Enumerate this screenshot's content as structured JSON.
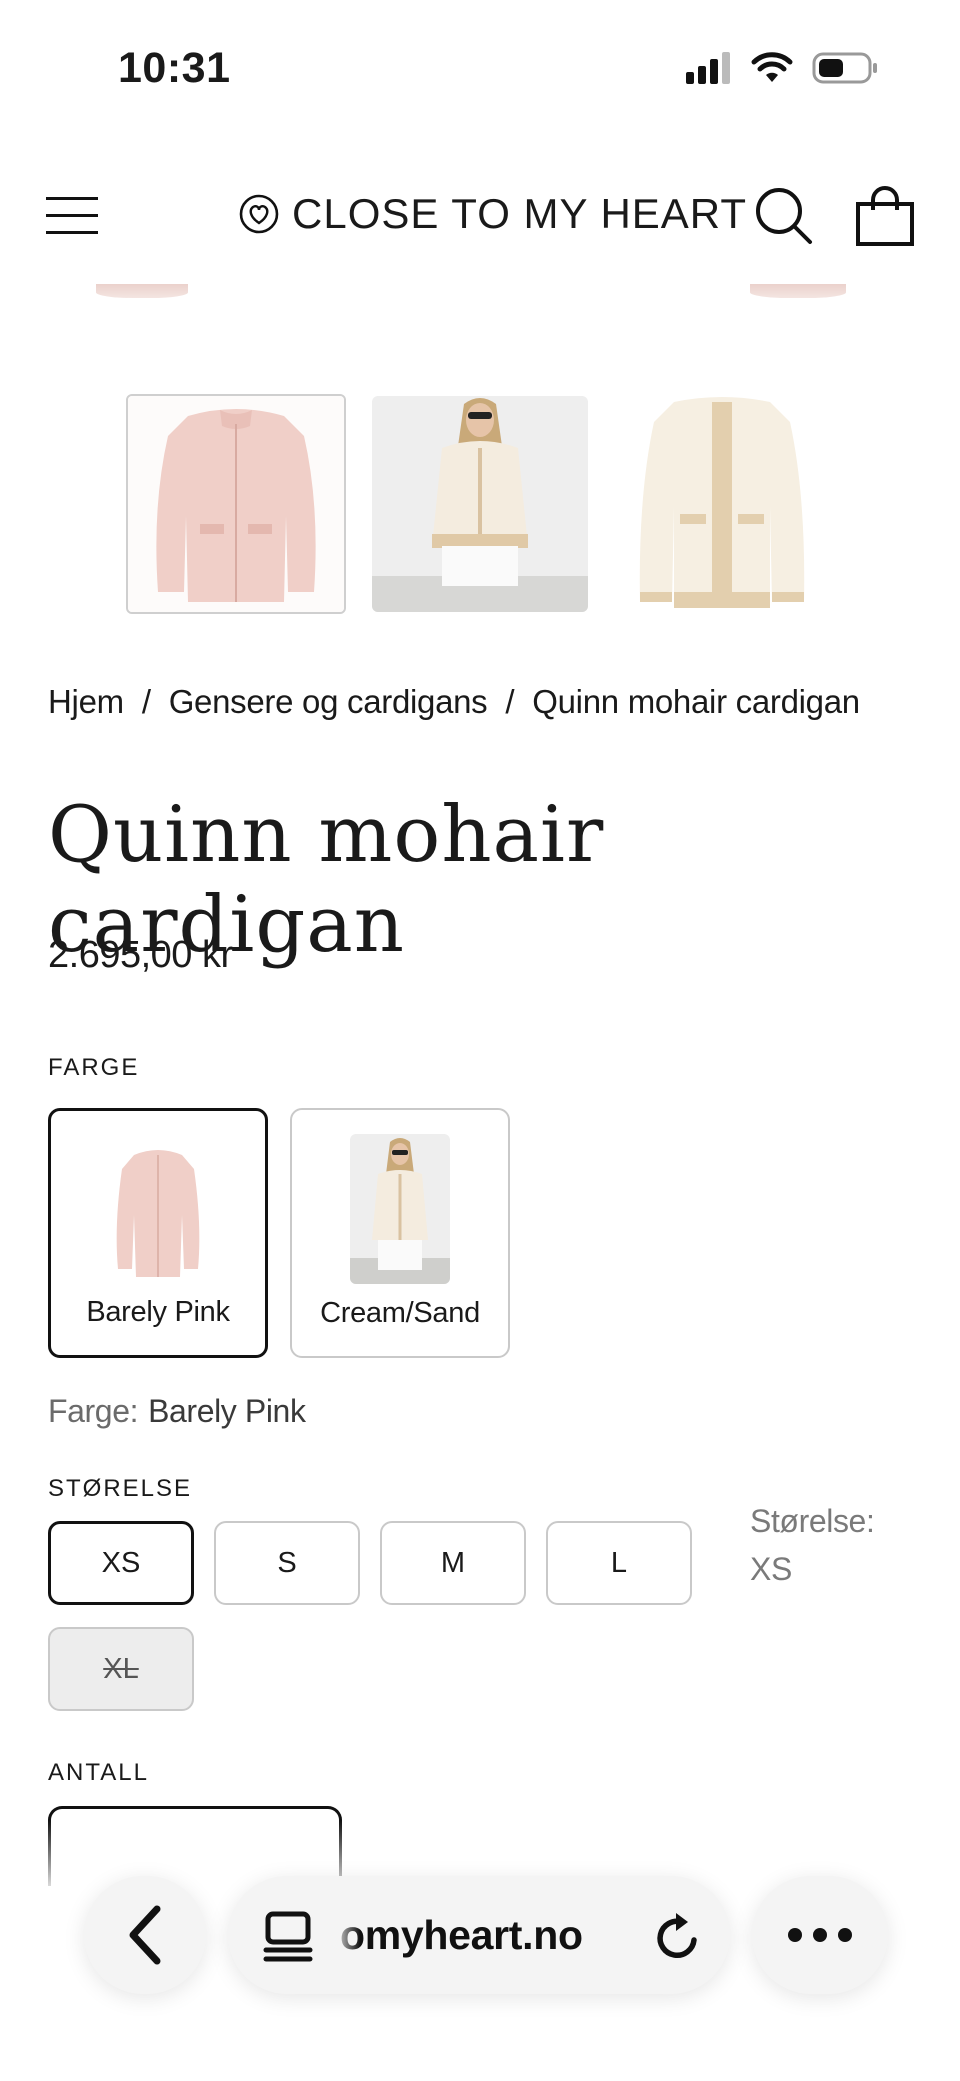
{
  "status_bar": {
    "time": "10:31"
  },
  "header": {
    "brand": "CLOSE TO MY HEART",
    "icons": {
      "menu": "hamburger-icon",
      "logo": "heart-logo-icon",
      "search": "search-icon",
      "cart": "shopping-bag-icon"
    }
  },
  "gallery": {
    "thumbnails": [
      {
        "alt": "Barely Pink cardigan",
        "active": true
      },
      {
        "alt": "Cream/Sand cardigan on model",
        "active": false
      },
      {
        "alt": "Cream/Sand cardigan",
        "active": false
      }
    ]
  },
  "breadcrumb": {
    "items": [
      "Hjem",
      "Gensere og cardigans",
      "Quinn mohair cardigan"
    ],
    "separator": "/"
  },
  "product": {
    "title": "Quinn mohair cardigan",
    "price": "2.695,00 kr"
  },
  "color": {
    "section_label": "FARGE",
    "options": [
      "Barely Pink",
      "Cream/Sand"
    ],
    "selected_prefix": "Farge:",
    "selected_value": "Barely Pink"
  },
  "size": {
    "section_label": "STØRELSE",
    "options": [
      "XS",
      "S",
      "M",
      "L",
      "XL"
    ],
    "selected": "XS",
    "unavailable": [
      "XL"
    ],
    "note_label": "Størelse:",
    "note_value": "XS"
  },
  "quantity": {
    "section_label": "ANTALL"
  },
  "browser": {
    "url": "omyheart.no",
    "icons": {
      "back": "chevron-left-icon",
      "tabs": "tab-overview-icon",
      "reload": "reload-icon",
      "more": "more-icon"
    }
  },
  "colors": {
    "accent": "#111111",
    "border": "#c9c9c9",
    "pink": "#f1d2cc",
    "cream": "#f3ebdc"
  }
}
